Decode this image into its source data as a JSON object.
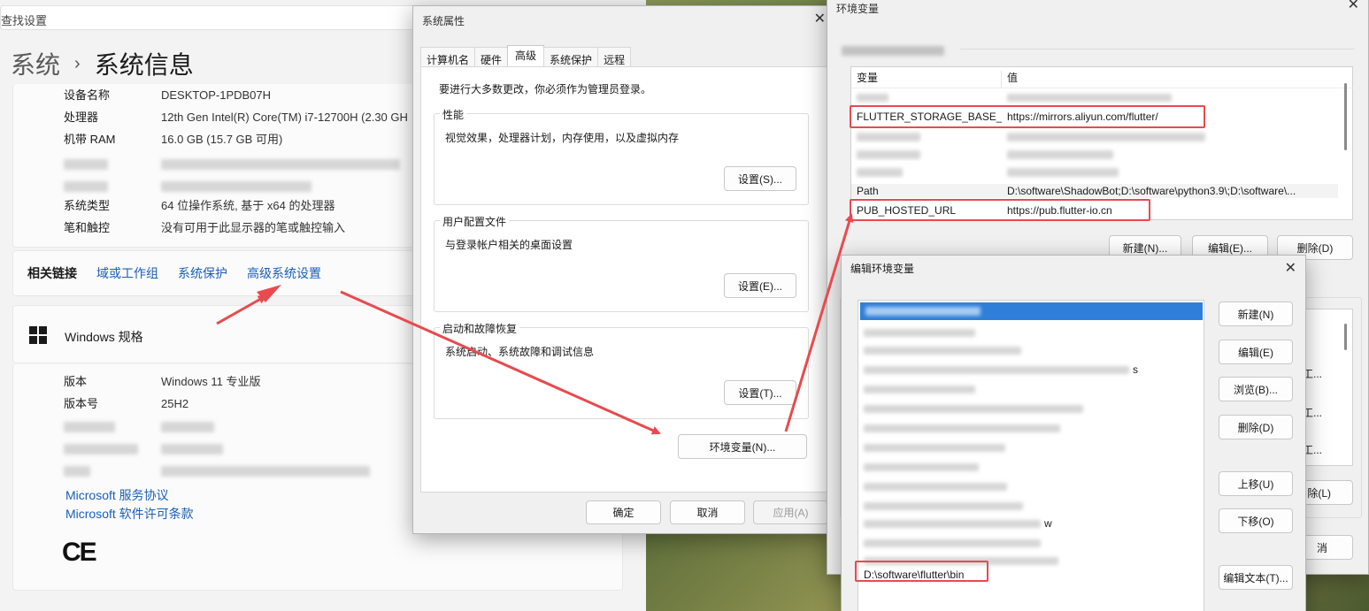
{
  "settings": {
    "search_text": "查找设置",
    "breadcrumb_parent": "系统",
    "breadcrumb_sep": "›",
    "breadcrumb_current": "系统信息",
    "device_specs": [
      {
        "key": "设备名称",
        "value": "DESKTOP-1PDB07H"
      },
      {
        "key": "处理器",
        "value": "12th Gen Intel(R) Core(TM) i7-12700H (2.30 GH"
      },
      {
        "key": "机带 RAM",
        "value": "16.0 GB (15.7 GB 可用)"
      }
    ],
    "device_specs_2": [
      {
        "key": "系统类型",
        "value": "64 位操作系统, 基于 x64 的处理器"
      },
      {
        "key": "笔和触控",
        "value": "没有可用于此显示器的笔或触控输入"
      }
    ],
    "related_links": {
      "title": "相关链接",
      "items": [
        "域或工作组",
        "系统保护",
        "高级系统设置"
      ]
    },
    "windows_spec": {
      "title": "Windows 规格",
      "rows": [
        {
          "key": "版本",
          "value": "Windows 11 专业版"
        },
        {
          "key": "版本号",
          "value": "25H2"
        }
      ]
    },
    "ms_links": [
      "Microsoft 服务协议",
      "Microsoft 软件许可条款"
    ],
    "ce_mark": "CE"
  },
  "system_properties": {
    "title": "系统属性",
    "tabs": [
      "计算机名",
      "硬件",
      "高级",
      "系统保护",
      "远程"
    ],
    "active_tab": "高级",
    "admin_note": "要进行大多数更改，你必须作为管理员登录。",
    "groups": [
      {
        "title": "性能",
        "desc": "视觉效果，处理器计划，内存使用，以及虚拟内存",
        "button": "设置(S)..."
      },
      {
        "title": "用户配置文件",
        "desc": "与登录帐户相关的桌面设置",
        "button": "设置(E)..."
      },
      {
        "title": "启动和故障恢复",
        "desc": "系统启动、系统故障和调试信息",
        "button": "设置(T)..."
      }
    ],
    "env_button": "环境变量(N)...",
    "ok": "确定",
    "cancel": "取消",
    "apply": "应用(A)"
  },
  "env_vars": {
    "title": "环境变量",
    "col_var": "变量",
    "col_val": "值",
    "rows": [
      {
        "name": "FLUTTER_STORAGE_BASE_...",
        "value": "https://mirrors.aliyun.com/flutter/"
      },
      {
        "name": "Path",
        "value": "D:\\software\\ShadowBot;D:\\software\\python3.9\\;D:\\software\\..."
      },
      {
        "name": "PUB_HOSTED_URL",
        "value": "https://pub.flutter-io.cn"
      }
    ],
    "new_btn": "新建(N)...",
    "edit_btn": "编辑(E)...",
    "delete_btn": "删除(D)",
    "partial_texts": [
      "新工...",
      "新工...",
      "新工...",
      "除(L)",
      "消"
    ]
  },
  "edit_env": {
    "title": "编辑环境变量",
    "partial_text_1": "s",
    "partial_text_2": "w",
    "highlighted_entry": "D:\\software\\flutter\\bin",
    "buttons": [
      "新建(N)",
      "编辑(E)",
      "浏览(B)...",
      "删除(D)",
      "上移(U)",
      "下移(O)",
      "编辑文本(T)..."
    ]
  },
  "colors": {
    "highlight": "#e84a4f",
    "link": "#1a5fb4",
    "selection": "#2f7fd8"
  }
}
